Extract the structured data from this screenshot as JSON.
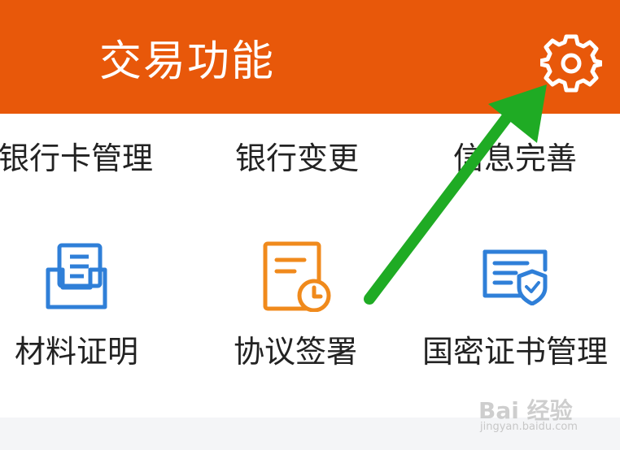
{
  "header": {
    "title": "交易功能",
    "settings_icon": "gear-icon",
    "background_color": "#e8580a"
  },
  "top_row": [
    {
      "label": "银行卡管理"
    },
    {
      "label": "银行变更"
    },
    {
      "label": "信息完善"
    }
  ],
  "grid": [
    {
      "label": "材料证明",
      "icon": "document-tray-icon",
      "icon_color": "#2f7fd8"
    },
    {
      "label": "协议签署",
      "icon": "document-clock-icon",
      "icon_color": "#f08a1c"
    },
    {
      "label": "国密证书管理",
      "icon": "certificate-shield-icon",
      "icon_color": "#2f7fd8"
    }
  ],
  "annotation": {
    "arrow_color": "#1fab24",
    "arrow_target": "settings"
  },
  "watermark": {
    "brand": "Bai 经验",
    "url": "jingyan.baidu.com"
  }
}
